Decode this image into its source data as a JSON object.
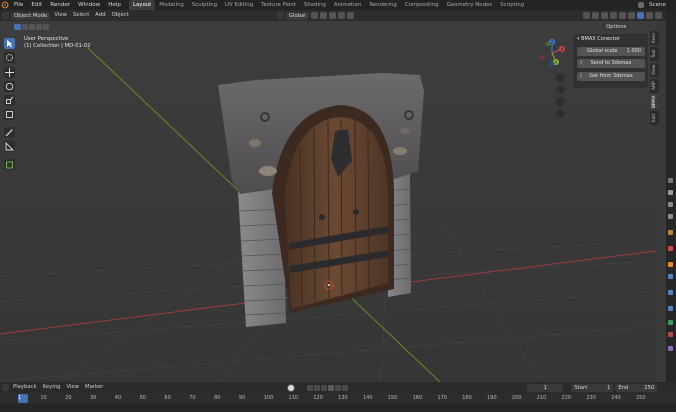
{
  "topbar": {
    "menus": [
      "File",
      "Edit",
      "Render",
      "Window",
      "Help"
    ],
    "workspaces": [
      "Layout",
      "Modeling",
      "Sculpting",
      "UV Editing",
      "Texture Paint",
      "Shading",
      "Animation",
      "Rendering",
      "Compositing",
      "Geometry Nodes",
      "Scripting"
    ],
    "active_workspace": "Layout",
    "scene_label": "Scene"
  },
  "header": {
    "mode": "Object Mode",
    "menus": [
      "View",
      "Select",
      "Add",
      "Object"
    ],
    "transform_orientation": "Global",
    "options_label": "Options"
  },
  "viewport": {
    "view_name": "User Perspective",
    "collection_info": "(1) Collection | MD-01-02",
    "gizmo": {
      "x": "X",
      "y": "Y",
      "z": "Z"
    }
  },
  "npanel": {
    "title": "BMAX Conector",
    "scale_label": "Global scale",
    "scale_value": "1.000",
    "send_button": "Send to 3dsmax",
    "get_button": "Get from 3dsmax"
  },
  "sidebar_tabs": [
    "Item",
    "Tool",
    "View",
    "ARP",
    "BMAX",
    "Edit"
  ],
  "active_sidebar_tab": "BMAX",
  "timeline": {
    "menus": [
      "Playback",
      "Keying",
      "View",
      "Marker"
    ],
    "current_frame": "1",
    "start_label": "Start",
    "start_value": "1",
    "end_label": "End",
    "end_value": "250",
    "ticks": [
      "1",
      "10",
      "20",
      "30",
      "40",
      "50",
      "60",
      "70",
      "80",
      "90",
      "100",
      "110",
      "120",
      "130",
      "140",
      "150",
      "160",
      "170",
      "180",
      "190",
      "200",
      "210",
      "220",
      "230",
      "240",
      "250"
    ]
  },
  "colors": {
    "accent": "#4772b3",
    "axis_x": "#c94a4a",
    "axis_y": "#8cb33b",
    "axis_z": "#3d7ed6",
    "playhead": "#4772b3"
  }
}
